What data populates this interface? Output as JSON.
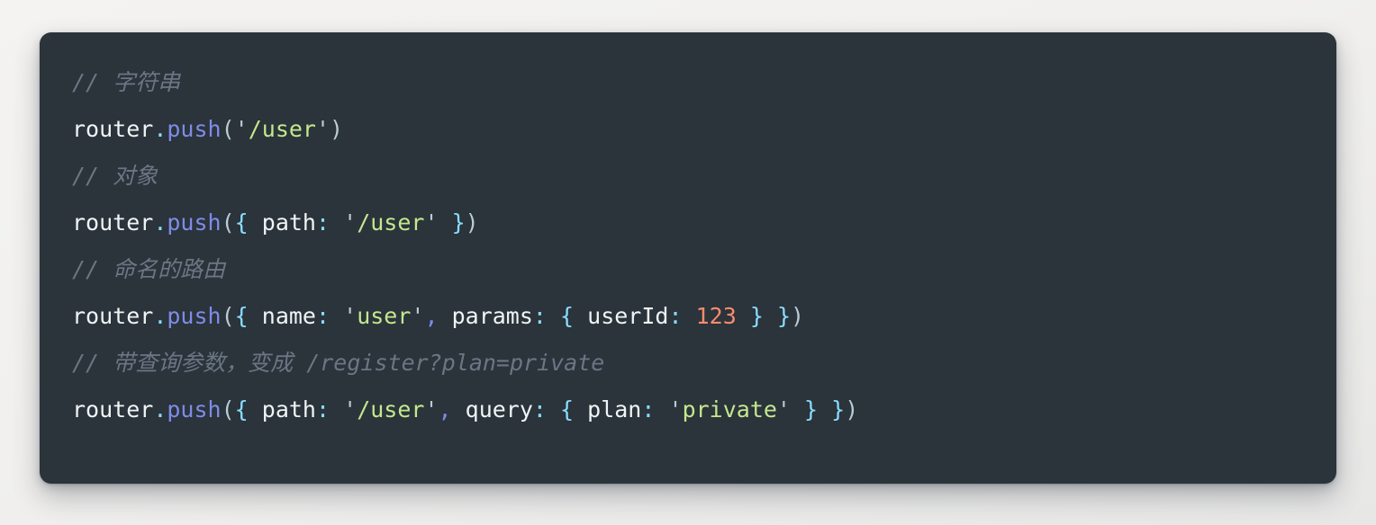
{
  "window": {
    "background_color": "#f1f0ee",
    "card_background_color": "#2b333b",
    "card_radius_px": 13
  },
  "theme": {
    "name": "material-palenight",
    "comment_color": "#6b7684",
    "plain_color": "#eff5f5",
    "method_color": "#7e8ce8",
    "brace_color": "#89ddff",
    "colon_color": "#89ddff",
    "comma_color": "#7e8ce8",
    "string_color": "#c3e88d",
    "number_color": "#f78c6c",
    "paren_color": "#b9ccd6"
  },
  "code_block": {
    "language": "javascript",
    "lines": [
      {
        "index": 1,
        "type": "comment",
        "text": "// 字符串",
        "tokens": [
          {
            "t": "comment",
            "v": "// 字符串"
          }
        ]
      },
      {
        "index": 2,
        "type": "code",
        "text": "router.push('/user')",
        "tokens": [
          {
            "t": "ident",
            "v": "router"
          },
          {
            "t": "dot",
            "v": "."
          },
          {
            "t": "method",
            "v": "push"
          },
          {
            "t": "paren",
            "v": "("
          },
          {
            "t": "quote",
            "v": "'"
          },
          {
            "t": "string",
            "v": "/user"
          },
          {
            "t": "quote",
            "v": "'"
          },
          {
            "t": "paren",
            "v": ")"
          }
        ]
      },
      {
        "index": 3,
        "type": "comment",
        "text": "// 对象",
        "tokens": [
          {
            "t": "comment",
            "v": "// 对象"
          }
        ]
      },
      {
        "index": 4,
        "type": "code",
        "text": "router.push({ path: '/user' })",
        "tokens": [
          {
            "t": "ident",
            "v": "router"
          },
          {
            "t": "dot",
            "v": "."
          },
          {
            "t": "method",
            "v": "push"
          },
          {
            "t": "paren",
            "v": "("
          },
          {
            "t": "brace",
            "v": "{"
          },
          {
            "t": "plain",
            "v": " "
          },
          {
            "t": "key",
            "v": "path"
          },
          {
            "t": "colon",
            "v": ":"
          },
          {
            "t": "plain",
            "v": " "
          },
          {
            "t": "quote",
            "v": "'"
          },
          {
            "t": "string",
            "v": "/user"
          },
          {
            "t": "quote",
            "v": "'"
          },
          {
            "t": "plain",
            "v": " "
          },
          {
            "t": "brace",
            "v": "}"
          },
          {
            "t": "paren",
            "v": ")"
          }
        ]
      },
      {
        "index": 5,
        "type": "comment",
        "text": "// 命名的路由",
        "tokens": [
          {
            "t": "comment",
            "v": "// 命名的路由"
          }
        ]
      },
      {
        "index": 6,
        "type": "code",
        "text": "router.push({ name: 'user', params: { userId: 123 } })",
        "tokens": [
          {
            "t": "ident",
            "v": "router"
          },
          {
            "t": "dot",
            "v": "."
          },
          {
            "t": "method",
            "v": "push"
          },
          {
            "t": "paren",
            "v": "("
          },
          {
            "t": "brace",
            "v": "{"
          },
          {
            "t": "plain",
            "v": " "
          },
          {
            "t": "key",
            "v": "name"
          },
          {
            "t": "colon",
            "v": ":"
          },
          {
            "t": "plain",
            "v": " "
          },
          {
            "t": "quote",
            "v": "'"
          },
          {
            "t": "string",
            "v": "user"
          },
          {
            "t": "quote",
            "v": "'"
          },
          {
            "t": "comma",
            "v": ","
          },
          {
            "t": "plain",
            "v": " "
          },
          {
            "t": "key",
            "v": "params"
          },
          {
            "t": "colon",
            "v": ":"
          },
          {
            "t": "plain",
            "v": " "
          },
          {
            "t": "brace",
            "v": "{"
          },
          {
            "t": "plain",
            "v": " "
          },
          {
            "t": "key",
            "v": "userId"
          },
          {
            "t": "colon",
            "v": ":"
          },
          {
            "t": "plain",
            "v": " "
          },
          {
            "t": "number",
            "v": "123"
          },
          {
            "t": "plain",
            "v": " "
          },
          {
            "t": "brace",
            "v": "}"
          },
          {
            "t": "plain",
            "v": " "
          },
          {
            "t": "brace",
            "v": "}"
          },
          {
            "t": "paren",
            "v": ")"
          }
        ]
      },
      {
        "index": 7,
        "type": "comment",
        "text": "// 带查询参数，变成 /register?plan=private",
        "tokens": [
          {
            "t": "comment",
            "v": "// 带查询参数，变成 /register?plan=private"
          }
        ]
      },
      {
        "index": 8,
        "type": "code",
        "text": "router.push({ path: '/user', query: { plan: 'private' } })",
        "tokens": [
          {
            "t": "ident",
            "v": "router"
          },
          {
            "t": "dot",
            "v": "."
          },
          {
            "t": "method",
            "v": "push"
          },
          {
            "t": "paren",
            "v": "("
          },
          {
            "t": "brace",
            "v": "{"
          },
          {
            "t": "plain",
            "v": " "
          },
          {
            "t": "key",
            "v": "path"
          },
          {
            "t": "colon",
            "v": ":"
          },
          {
            "t": "plain",
            "v": " "
          },
          {
            "t": "quote",
            "v": "'"
          },
          {
            "t": "string",
            "v": "/user"
          },
          {
            "t": "quote",
            "v": "'"
          },
          {
            "t": "comma",
            "v": ","
          },
          {
            "t": "plain",
            "v": " "
          },
          {
            "t": "key",
            "v": "query"
          },
          {
            "t": "colon",
            "v": ":"
          },
          {
            "t": "plain",
            "v": " "
          },
          {
            "t": "brace",
            "v": "{"
          },
          {
            "t": "plain",
            "v": " "
          },
          {
            "t": "key",
            "v": "plan"
          },
          {
            "t": "colon",
            "v": ":"
          },
          {
            "t": "plain",
            "v": " "
          },
          {
            "t": "quote",
            "v": "'"
          },
          {
            "t": "string",
            "v": "private"
          },
          {
            "t": "quote",
            "v": "'"
          },
          {
            "t": "plain",
            "v": " "
          },
          {
            "t": "brace",
            "v": "}"
          },
          {
            "t": "plain",
            "v": " "
          },
          {
            "t": "brace",
            "v": "}"
          },
          {
            "t": "paren",
            "v": ")"
          }
        ]
      }
    ]
  }
}
